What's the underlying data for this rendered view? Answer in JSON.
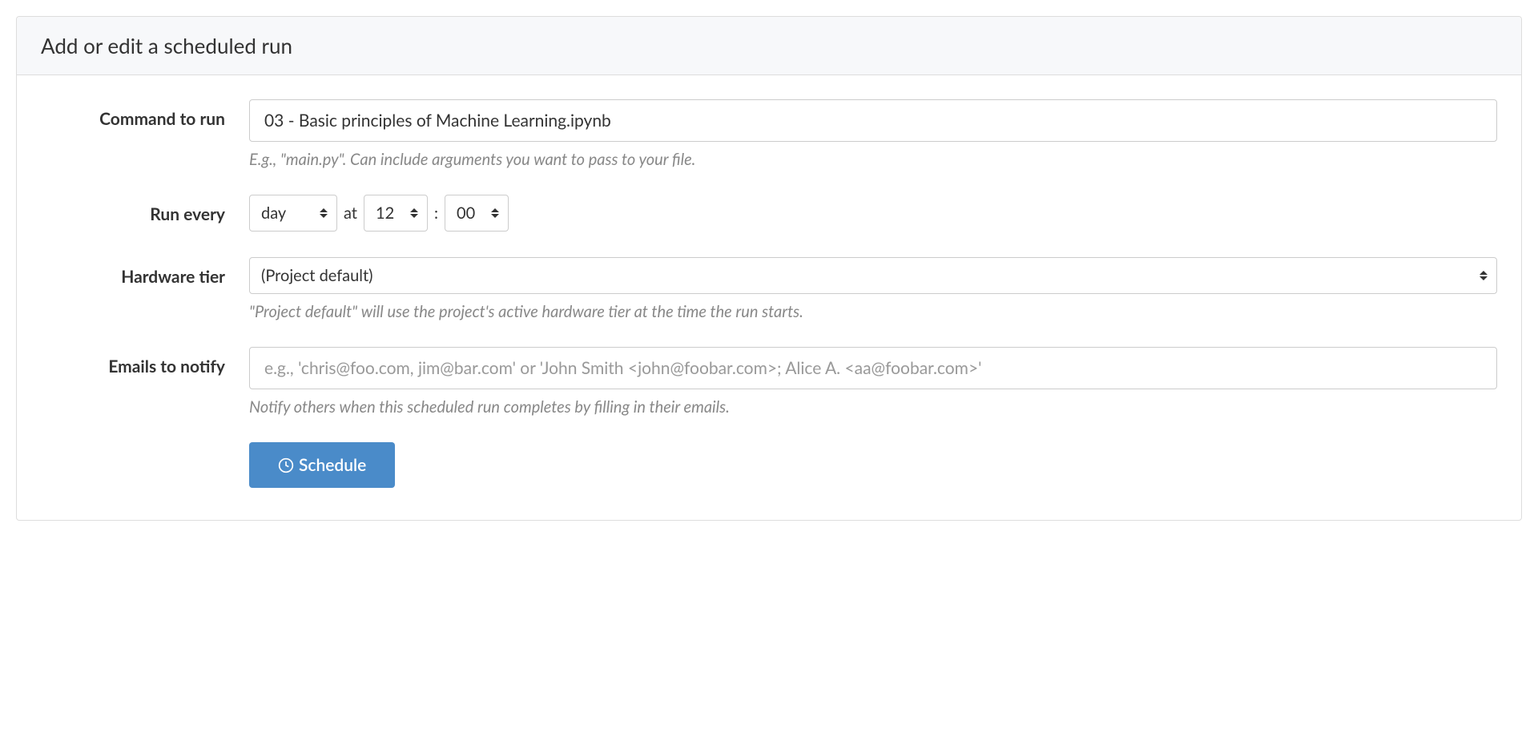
{
  "header": {
    "title": "Add or edit a scheduled run"
  },
  "form": {
    "command": {
      "label": "Command to run",
      "value": "03 - Basic principles of Machine Learning.ipynb",
      "help": "E.g., \"main.py\". Can include arguments you want to pass to your file."
    },
    "runEvery": {
      "label": "Run every",
      "period": "day",
      "atText": "at",
      "hour": "12",
      "colon": ":",
      "minute": "00"
    },
    "hardwareTier": {
      "label": "Hardware tier",
      "value": "(Project default)",
      "help": "\"Project default\" will use the project's active hardware tier at the time the run starts."
    },
    "emails": {
      "label": "Emails to notify",
      "value": "",
      "placeholder": "e.g., 'chris@foo.com, jim@bar.com' or 'John Smith <john@foobar.com>; Alice A. <aa@foobar.com>'",
      "help": "Notify others when this scheduled run completes by filling in their emails."
    },
    "submit": {
      "label": "Schedule"
    }
  }
}
